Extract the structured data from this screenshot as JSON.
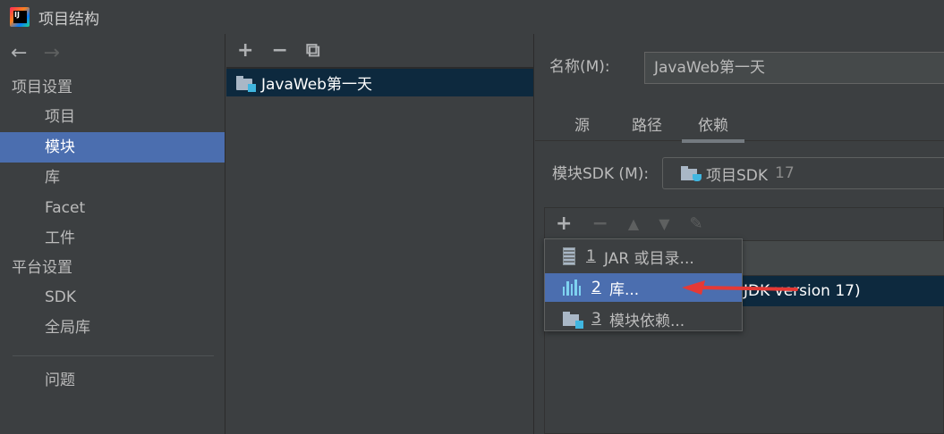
{
  "window": {
    "title": "项目结构"
  },
  "nav": {
    "back": "←",
    "forward": "→"
  },
  "sidebar": {
    "section_project": "项目设置",
    "project_items": [
      {
        "label": "项目"
      },
      {
        "label": "模块"
      },
      {
        "label": "库"
      },
      {
        "label": "Facet"
      },
      {
        "label": "工件"
      }
    ],
    "section_platform": "平台设置",
    "platform_items": [
      {
        "label": "SDK"
      },
      {
        "label": "全局库"
      }
    ],
    "problems": "问题"
  },
  "middle": {
    "toolbar": {
      "add": "+",
      "remove": "−",
      "copy": "⧉"
    },
    "modules": [
      {
        "label": "JavaWeb第一天"
      }
    ]
  },
  "right": {
    "name_label": "名称(M):",
    "name_value": "JavaWeb第一天",
    "tabs": [
      {
        "label": "源"
      },
      {
        "label": "路径"
      },
      {
        "label": "依赖"
      }
    ],
    "sdk_label": "模块SDK (M):",
    "sdk_value": "项目SDK",
    "sdk_version": "17",
    "dep_toolbar": {
      "add": "+",
      "remove": "−",
      "up": "▲",
      "down": "▼",
      "edit": "✎"
    },
    "dep_selected_text": "JDK version 17)"
  },
  "popup": {
    "items": [
      {
        "num": "1",
        "label": "JAR 或目录..."
      },
      {
        "num": "2",
        "label": "库..."
      },
      {
        "num": "3",
        "label": "模块依赖..."
      }
    ]
  },
  "colors": {
    "selection_blue": "#4b6eaf",
    "selected_row": "#0d293e",
    "annotation_arrow": "#e53935"
  }
}
